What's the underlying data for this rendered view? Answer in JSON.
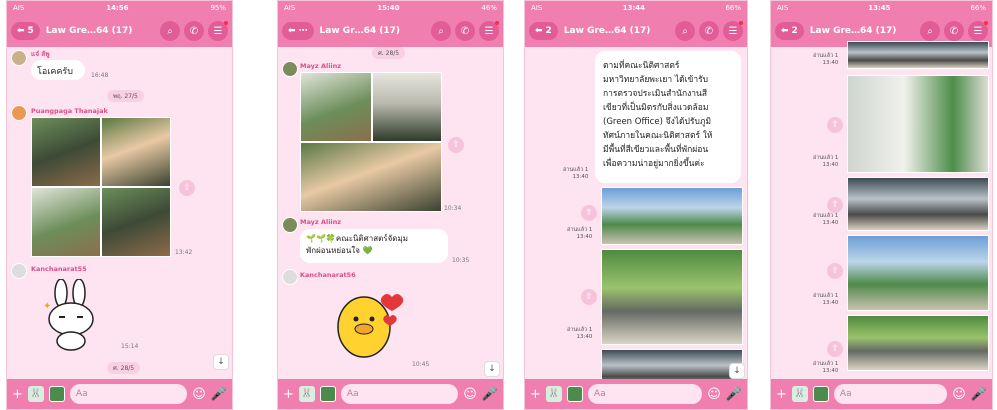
{
  "panels": [
    {
      "status_carrier": "AIS",
      "status_time": "14:56",
      "status_battery": "95%",
      "back_badge": "5",
      "title": "Law Gre…64 (17)",
      "messages": {
        "first_sender": "แจ๋ ลัพู",
        "first_text": "โอเคครับ",
        "first_time": "16:48",
        "date_pill": "พฤ. 27/5",
        "second_sender": "Puangpaga Thanajak",
        "second_time": "13:42",
        "third_sender": "Kanchanarat55",
        "third_time": "15:14",
        "date_pill_2": "ศ. 28/5"
      },
      "input_placeholder": "Aa"
    },
    {
      "status_carrier": "AIS",
      "status_time": "15:40",
      "status_battery": "46%",
      "title": "Law Gr…64 (17)",
      "messages": {
        "date_pill": "ศ. 28/5",
        "first_sender": "Mayz Aliinz",
        "first_time": "10:34",
        "second_sender": "Mayz Aliinz",
        "second_text_1": "🌱🌱🍀คณะนิติศาสตร์จัดมุม",
        "second_text_2": "พักผ่อนหย่อนใจ 💚",
        "second_time": "10:35",
        "third_sender": "Kanchanarat56",
        "third_time": "10:45"
      },
      "input_placeholder": "Aa"
    },
    {
      "status_carrier": "AIS",
      "status_time": "13:44",
      "status_battery": "66%",
      "back_badge": "2",
      "title": "Law Gre…64 (17)",
      "messages": {
        "text_lines": [
          "ตามที่คณะนิติศาสตร์",
          "มหาวิทยาลัยพะเยา ได้เข้ารับ",
          "การตรวจประเมินสำนักงานสี",
          "เขียวที่เป็นมิตรกับสิ่งแวดล้อม",
          "(Green Office) จึงได้ปรับภูมิ",
          "ทัศน์ภายในคณะนิติศาสตร์ ให้",
          "มีพื้นที่สีเขียวและพื้นที่พักผ่อน",
          "เพื่อความน่าอยู่มากยิ่งขึ้นค่ะ"
        ],
        "read_label": "อ่านแล้ว 1",
        "time": "13:40"
      },
      "input_placeholder": "Aa"
    },
    {
      "status_carrier": "AIS",
      "status_time": "13:45",
      "status_battery": "66%",
      "back_badge": "2",
      "title": "Law Gre…64 (17)",
      "messages": {
        "read_label": "อ่านแล้ว 1",
        "time": "13:40"
      },
      "input_placeholder": "Aa"
    }
  ],
  "icons": {
    "back": "arrow-left-icon",
    "search": "search-icon",
    "call": "phone-icon",
    "menu": "menu-icon",
    "plus": "plus-icon",
    "mic": "mic-icon"
  },
  "colors": {
    "header": "#f07fb0",
    "chat_bg": "#fde4f0",
    "sender": "#d94f8b"
  }
}
